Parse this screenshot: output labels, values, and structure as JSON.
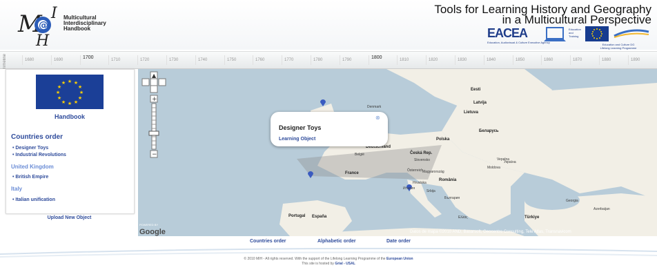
{
  "header": {
    "logo_line1": "Multicultural",
    "logo_line2": "Interdisciplinary",
    "logo_line3": "Handbook",
    "title_line1": "Tools for Learning History and Geography",
    "title_line2": "in a Multicultural Perspective",
    "eacea": "EACEA",
    "eacea_sub": "Education, Audiovisual & Culture Executive Agency",
    "edu_text": "Education and Training",
    "llp_text": "Lifelong Learning Programme",
    "llp_sub": "Education and Culture DG"
  },
  "timeline": {
    "label": "Timeline",
    "ticks": [
      "1680",
      "1690",
      "1700",
      "1710",
      "1720",
      "1730",
      "1740",
      "1750",
      "1760",
      "1770",
      "1780",
      "1790",
      "1800",
      "1810",
      "1820",
      "1830",
      "1840",
      "1850",
      "1860",
      "1870",
      "1880",
      "1890"
    ],
    "major": [
      "1700",
      "1800"
    ]
  },
  "sidebar": {
    "handbook": "Handbook",
    "countries_title": "Countries order",
    "groups": [
      {
        "country": "",
        "items": [
          "Designer Toys",
          "Industrial Revolutions"
        ]
      },
      {
        "country": "United Kingdom",
        "items": [
          "British Empire"
        ]
      },
      {
        "country": "Italy",
        "items": [
          "Italian unification"
        ]
      }
    ],
    "upload": "Upload New Object"
  },
  "map": {
    "popup_title": "Designer Toys",
    "popup_link": "Learning Object",
    "popup_close": "⊗",
    "google": "Google",
    "powered": "POWERED BY",
    "attribution": "Datos de mapa ©2010 AND, Basarsoft, Geocentre Consulting, Tele Atlas, Transnavicom",
    "labels": [
      {
        "name": "Eesti",
        "big": true
      },
      {
        "name": "Latvija",
        "big": true
      },
      {
        "name": "Lietuva",
        "big": true
      },
      {
        "name": "Беларусь",
        "big": true
      },
      {
        "name": "Polska",
        "big": true
      },
      {
        "name": "Česká Rep.",
        "big": true
      },
      {
        "name": "Deutschland",
        "big": true
      },
      {
        "name": "België",
        "big": false
      },
      {
        "name": "France",
        "big": true
      },
      {
        "name": "Slovensko",
        "big": false
      },
      {
        "name": "Österreich",
        "big": false
      },
      {
        "name": "Magyarország",
        "big": false
      },
      {
        "name": "Moldova",
        "big": false
      },
      {
        "name": "Україна",
        "big": false
      },
      {
        "name": "România",
        "big": true
      },
      {
        "name": "Hrvatska",
        "big": false
      },
      {
        "name": "Srbija",
        "big": false
      },
      {
        "name": "Италия",
        "big": false
      },
      {
        "name": "България",
        "big": false
      },
      {
        "name": "Portugal",
        "big": true
      },
      {
        "name": "España",
        "big": true
      },
      {
        "name": "Ελλάς",
        "big": false
      },
      {
        "name": "Türkiye",
        "big": true
      },
      {
        "name": "Georgia",
        "big": false
      },
      {
        "name": "Azerbaijan",
        "big": false
      },
      {
        "name": "Denmark",
        "big": false
      },
      {
        "name": "Vepalna",
        "big": false
      }
    ]
  },
  "bottom_links": [
    "Countries order",
    "Alphabetic order",
    "Date order"
  ],
  "footer": {
    "line1_prefix": "© 2010 MIH - All rights reserved. With the support of the Lifelong Learning Programme of the",
    "line1_link": "European Union",
    "line2_prefix": "This site is hosted by",
    "line2_link": "Grial - USAL"
  },
  "colors": {
    "link": "#2e4b9b",
    "country": "#6a8cd6",
    "sea": "#b8ccd9",
    "land": "#f2efe6",
    "eu_blue": "#1b3f97"
  }
}
